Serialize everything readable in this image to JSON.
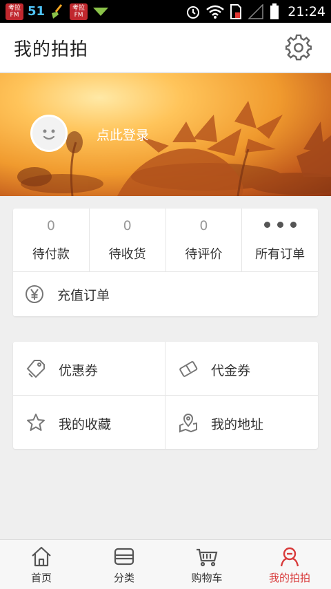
{
  "status_bar": {
    "app_badge_1": "考拉FM",
    "number": "51",
    "app_badge_2": "考拉FM",
    "time": "21:24"
  },
  "header": {
    "title": "我的拍拍",
    "settings_icon": "gear-icon"
  },
  "banner": {
    "login_text": "点此登录",
    "avatar_icon": "smiley-avatar-icon"
  },
  "orders": {
    "items": [
      {
        "count": "0",
        "label": "待付款"
      },
      {
        "count": "0",
        "label": "待收货"
      },
      {
        "count": "0",
        "label": "待评价"
      },
      {
        "label": "所有订单",
        "icon": "more-dots-icon"
      }
    ],
    "recharge": {
      "label": "充值订单",
      "icon": "yen-icon"
    }
  },
  "services": [
    {
      "label": "优惠券",
      "icon": "coupon-tag-icon"
    },
    {
      "label": "代金券",
      "icon": "voucher-icon"
    },
    {
      "label": "我的收藏",
      "icon": "star-icon"
    },
    {
      "label": "我的地址",
      "icon": "map-pin-icon"
    }
  ],
  "tabbar": {
    "tabs": [
      {
        "label": "首页",
        "icon": "home-icon"
      },
      {
        "label": "分类",
        "icon": "category-icon"
      },
      {
        "label": "购物车",
        "icon": "cart-icon"
      },
      {
        "label": "我的拍拍",
        "icon": "user-icon",
        "active": true
      }
    ]
  },
  "colors": {
    "accent": "#d83a3a",
    "background": "#efefef"
  }
}
